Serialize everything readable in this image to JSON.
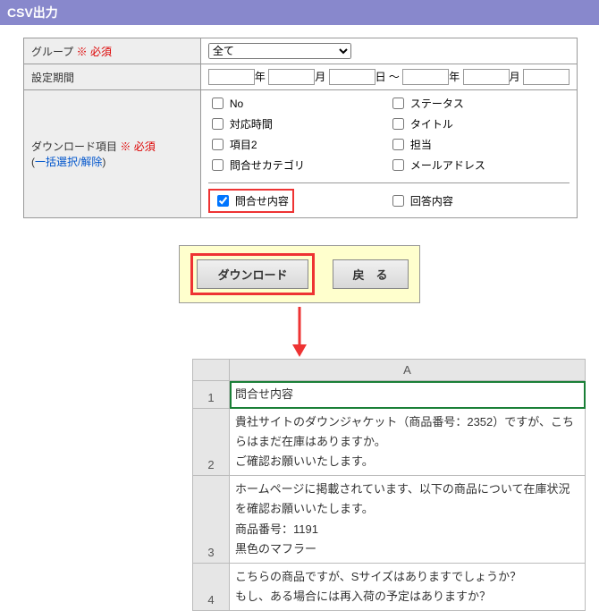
{
  "header": {
    "title": "CSV出力"
  },
  "form": {
    "group": {
      "label": "グループ",
      "required_mark": "※ 必須",
      "selected": "全て"
    },
    "period": {
      "label": "設定期間",
      "y": "年",
      "m": "月",
      "d": "日",
      "sep": "～"
    },
    "download": {
      "label": "ダウンロード項目",
      "required_mark": "※ 必須",
      "bulk_link": "一括選択/解除",
      "items": {
        "no": "No",
        "status": "ステータス",
        "time": "対応時間",
        "title_c": "タイトル",
        "item2": "項目2",
        "assignee": "担当",
        "category": "問合せカテゴリ",
        "mail": "メールアドレス",
        "inquiry": "問合せ内容",
        "answer": "回答内容"
      }
    }
  },
  "buttons": {
    "download": "ダウンロード",
    "back": "戻　る"
  },
  "excel": {
    "col": "A",
    "rows": [
      "問合せ内容",
      "貴社サイトのダウンジャケット（商品番号：2352）ですが、こちらはまだ在庫はありますか。\nご確認お願いいたします。",
      "ホームページに掲載されています、以下の商品について在庫状況を確認お願いいたします。\n商品番号：1191\n黒色のマフラー",
      "こちらの商品ですが、Sサイズはありますでしょうか？\nもし、ある場合には再入荷の予定はありますか？"
    ]
  }
}
